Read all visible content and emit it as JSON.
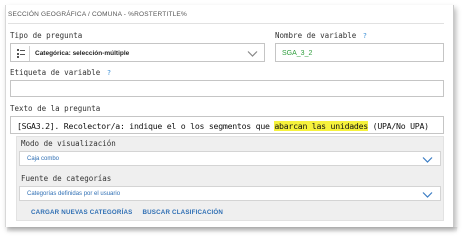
{
  "breadcrumb": "SECCIÓN GEOGRÁFICA / COMUNA - %ROSTERTITLE%",
  "tipo_pregunta": {
    "label": "Tipo de pregunta",
    "value": "Categórica: selección-múltiple",
    "icon": "list-checkbox-icon"
  },
  "nombre_variable": {
    "label": "Nombre de variable",
    "help": "?",
    "value": "SGA_3_2"
  },
  "etiqueta_variable": {
    "label": "Etiqueta de variable",
    "help": "?",
    "value": ""
  },
  "texto_pregunta": {
    "label": "Texto de la pregunta",
    "before": "[SGA3.2]. Recolector/a: indique el o los segmentos que ",
    "highlight": "abarcan las unidades",
    "after": " (UPA/No UPA)"
  },
  "modo_visualizacion": {
    "label": "Modo de visualización",
    "value": "Caja combo"
  },
  "fuente_categorias": {
    "label": "Fuente de categorías",
    "value": "Categorías definidas por el usuario"
  },
  "links": {
    "cargar": "CARGAR NUEVAS CATEGORÍAS",
    "buscar": "BUSCAR CLASIFICACIÓN"
  },
  "colors": {
    "accent": "#2f6fb4",
    "variable_green": "#2e9e3c",
    "highlight": "#f6f23c"
  }
}
